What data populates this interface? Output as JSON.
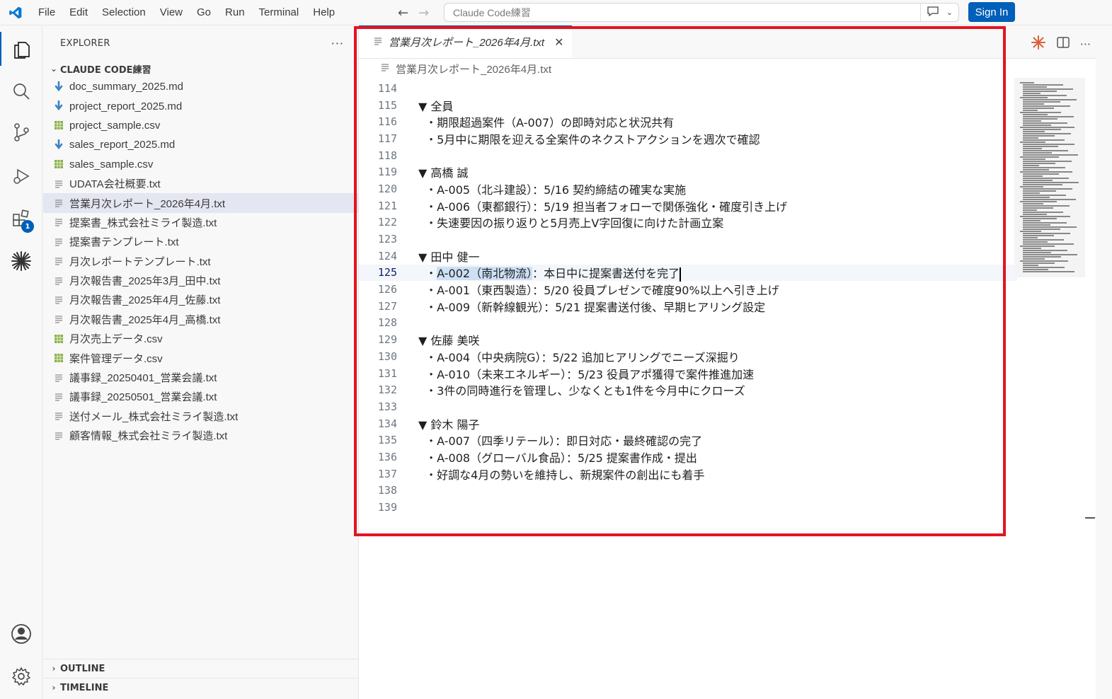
{
  "menu": [
    "File",
    "Edit",
    "Selection",
    "View",
    "Go",
    "Run",
    "Terminal",
    "Help"
  ],
  "command_center": {
    "text": "Claude Code練習"
  },
  "sign_in": "Sign In",
  "activity": {
    "extensions_badge": "1"
  },
  "explorer": {
    "title": "EXPLORER",
    "more": "···",
    "folder": "CLAUDE CODE練習",
    "files": [
      {
        "name": "doc_summary_2025.md",
        "icon": "markdown-icon"
      },
      {
        "name": "project_report_2025.md",
        "icon": "markdown-icon"
      },
      {
        "name": "project_sample.csv",
        "icon": "csv-icon"
      },
      {
        "name": "sales_report_2025.md",
        "icon": "markdown-icon"
      },
      {
        "name": "sales_sample.csv",
        "icon": "csv-icon"
      },
      {
        "name": "UDATA会社概要.txt",
        "icon": "text-icon"
      },
      {
        "name": "営業月次レポート_2026年4月.txt",
        "icon": "text-icon",
        "selected": true
      },
      {
        "name": "提案書_株式会社ミライ製造.txt",
        "icon": "text-icon"
      },
      {
        "name": "提案書テンプレート.txt",
        "icon": "text-icon"
      },
      {
        "name": "月次レポートテンプレート.txt",
        "icon": "text-icon"
      },
      {
        "name": "月次報告書_2025年3月_田中.txt",
        "icon": "text-icon"
      },
      {
        "name": "月次報告書_2025年4月_佐藤.txt",
        "icon": "text-icon"
      },
      {
        "name": "月次報告書_2025年4月_高橋.txt",
        "icon": "text-icon"
      },
      {
        "name": "月次売上データ.csv",
        "icon": "csv-icon"
      },
      {
        "name": "案件管理データ.csv",
        "icon": "csv-icon"
      },
      {
        "name": "議事録_20250401_営業会議.txt",
        "icon": "text-icon"
      },
      {
        "name": "議事録_20250501_営業会議.txt",
        "icon": "text-icon"
      },
      {
        "name": "送付メール_株式会社ミライ製造.txt",
        "icon": "text-icon"
      },
      {
        "name": "顧客情報_株式会社ミライ製造.txt",
        "icon": "text-icon"
      }
    ],
    "outline": "OUTLINE",
    "timeline": "TIMELINE"
  },
  "editor": {
    "tab": "営業月次レポート_2026年4月.txt",
    "breadcrumb": "営業月次レポート_2026年4月.txt",
    "current_line": 125,
    "lines": [
      {
        "n": "114",
        "t": ""
      },
      {
        "n": "115",
        "t": "▼ 全員"
      },
      {
        "n": "116",
        "t": "  ・期限超過案件（A-007）の即時対応と状況共有"
      },
      {
        "n": "117",
        "t": "  ・5月中に期限を迎える全案件のネクストアクションを週次で確認"
      },
      {
        "n": "118",
        "t": ""
      },
      {
        "n": "119",
        "t": "▼ 高橋 誠"
      },
      {
        "n": "120",
        "t": "  ・A-005（北斗建設）：5/16 契約締結の確実な実施"
      },
      {
        "n": "121",
        "t": "  ・A-006（東都銀行）：5/19 担当者フォローで関係強化・確度引き上げ"
      },
      {
        "n": "122",
        "t": "  ・失速要因の振り返りと5月売上V字回復に向けた計画立案"
      },
      {
        "n": "123",
        "t": ""
      },
      {
        "n": "124",
        "t": "▼ 田中 健一"
      },
      {
        "n": "125",
        "t": "  ・A-002（南北物流）：本日中に提案書送付を完了",
        "sel_start": "A-002（南北物流）"
      },
      {
        "n": "126",
        "t": "  ・A-001（東西製造）：5/20 役員プレゼンで確度90%以上へ引き上げ"
      },
      {
        "n": "127",
        "t": "  ・A-009（新幹線観光）：5/21 提案書送付後、早期ヒアリング設定"
      },
      {
        "n": "128",
        "t": ""
      },
      {
        "n": "129",
        "t": "▼ 佐藤 美咲"
      },
      {
        "n": "130",
        "t": "  ・A-004（中央病院G）：5/22 追加ヒアリングでニーズ深掘り"
      },
      {
        "n": "131",
        "t": "  ・A-010（未来エネルギー）：5/23 役員アポ獲得で案件推進加速"
      },
      {
        "n": "132",
        "t": "  ・3件の同時進行を管理し、少なくとも1件を今月中にクローズ"
      },
      {
        "n": "133",
        "t": ""
      },
      {
        "n": "134",
        "t": "▼ 鈴木 陽子"
      },
      {
        "n": "135",
        "t": "  ・A-007（四季リテール）：即日対応・最終確認の完了"
      },
      {
        "n": "136",
        "t": "  ・A-008（グローバル食品）：5/25 提案書作成・提出"
      },
      {
        "n": "137",
        "t": "  ・好調な4月の勢いを維持し、新規案件の創出にも着手"
      },
      {
        "n": "138",
        "t": ""
      },
      {
        "n": "139",
        "t": ""
      }
    ]
  },
  "colors": {
    "accent": "#005fb8",
    "highlight_box": "#e3141f",
    "selection": "#cde0f5"
  }
}
